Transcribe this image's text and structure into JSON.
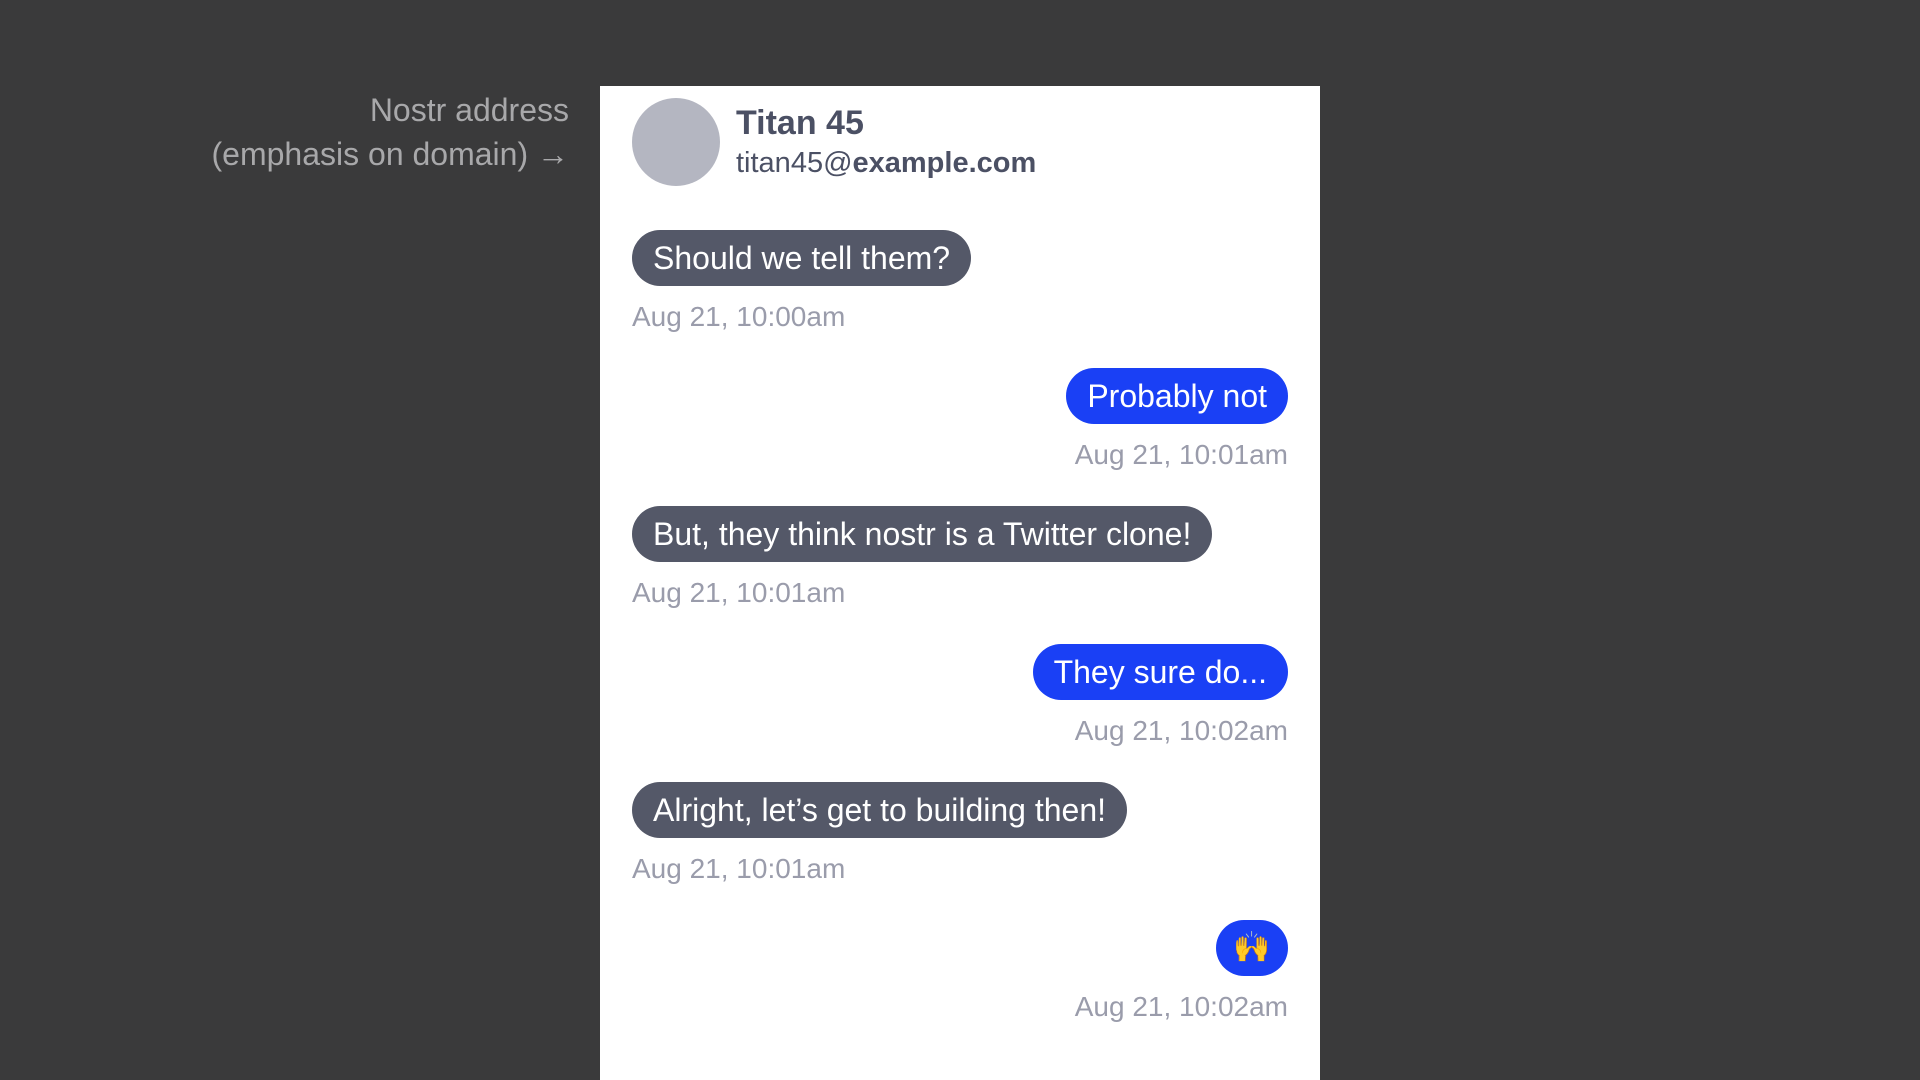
{
  "annotation": {
    "line1": "Nostr address",
    "line2": "(emphasis on domain) →"
  },
  "contact": {
    "name": "Titan 45",
    "address_user": "titan45@",
    "address_domain": "example.com"
  },
  "colors": {
    "background": "#3a3a3b",
    "incoming_bubble": "#545868",
    "outgoing_bubble": "#1a40f5",
    "timestamp": "#9a9cab",
    "avatar": "#b4b6c1"
  },
  "messages": [
    {
      "direction": "incoming",
      "text": "Should we tell them?",
      "time": "Aug 21, 10:00am"
    },
    {
      "direction": "outgoing",
      "text": "Probably not",
      "time": "Aug 21, 10:01am"
    },
    {
      "direction": "incoming",
      "text": "But, they think nostr is a Twitter clone!",
      "time": "Aug 21, 10:01am"
    },
    {
      "direction": "outgoing",
      "text": "They sure do...",
      "time": "Aug 21, 10:02am"
    },
    {
      "direction": "incoming",
      "text": "Alright, let’s get to building then!",
      "time": "Aug 21, 10:01am"
    },
    {
      "direction": "outgoing",
      "text": "🙌",
      "time": "Aug 21, 10:02am"
    }
  ]
}
